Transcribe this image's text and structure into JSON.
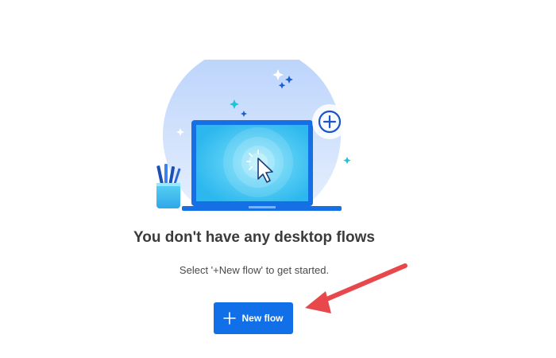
{
  "empty_state": {
    "title": "You don't have any desktop flows",
    "subtitle": "Select '+New flow' to get started."
  },
  "actions": {
    "new_flow_label": "New flow"
  },
  "icons": {
    "illustration": "laptop-cursor-illustration",
    "button_icon": "plus-icon",
    "annotation": "red-arrow-icon"
  },
  "colors": {
    "accent": "#1170e8",
    "annotation": "#e8474b"
  }
}
